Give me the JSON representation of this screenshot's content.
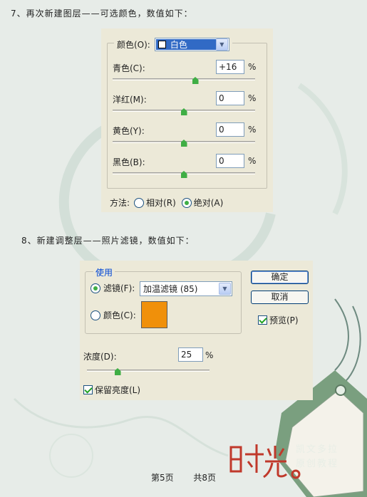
{
  "step7": "7、再次新建图层——可选颜色，数值如下：",
  "selective_color": {
    "colors_label": "颜色(O):",
    "colors_value": "白色",
    "rows": [
      {
        "label": "青色(C):",
        "value": "+16",
        "unit": "%",
        "slider_level": 0.58
      },
      {
        "label": "洋红(M):",
        "value": "0",
        "unit": "%",
        "slider_level": 0.5
      },
      {
        "label": "黄色(Y):",
        "value": "0",
        "unit": "%",
        "slider_level": 0.5
      },
      {
        "label": "黑色(B):",
        "value": "0",
        "unit": "%",
        "slider_level": 0.5
      }
    ],
    "method_label": "方法:",
    "relative_label": "相对(R)",
    "absolute_label": "绝对(A)",
    "selected_method": "absolute"
  },
  "step8": "8、新建调整层——照片滤镜，数值如下：",
  "photo_filter": {
    "use_label": "使用",
    "filter_label": "滤镜(F):",
    "filter_value": "加温滤镜 (85)",
    "color_label": "颜色(C):",
    "color_swatch": "#f0900a",
    "ok_label": "确定",
    "cancel_label": "取消",
    "preview_label": "预览(P)",
    "density_label": "浓度(D):",
    "density_value": "25",
    "density_unit": "%",
    "density_level": 0.25,
    "preserve_label": "保留亮度(L)"
  },
  "footer": {
    "page": "第5页",
    "total": "共8页"
  },
  "brand": {
    "line1": "凯文多拉",
    "line2": "原创教程"
  },
  "colors": {
    "accent": "#3fae45",
    "panel": "#ece9d8",
    "selection": "#316ac5",
    "logo_red": "#c0392b",
    "tag_green": "#7a9f7f"
  }
}
